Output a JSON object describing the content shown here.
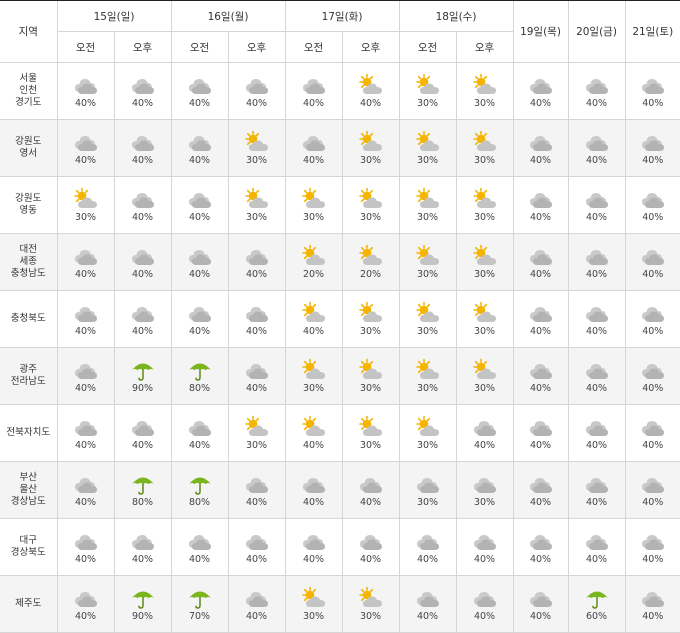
{
  "header": {
    "region_label": "지역",
    "am_label": "오전",
    "pm_label": "오후",
    "days_split": [
      "15일(일)",
      "16일(월)",
      "17일(화)",
      "18일(수)"
    ],
    "days_single": [
      "19일(목)",
      "20일(금)",
      "21일(토)"
    ]
  },
  "icon_legend": {
    "cloud": "cloudy-icon",
    "sun": "partly-sunny-icon",
    "umbrella": "umbrella-rain-icon"
  },
  "colors": {
    "cloud": "#b3b3b3",
    "sun": "#f5b400",
    "umbrella": "#7ab51d",
    "row_shade": "#f4f4f4"
  },
  "rows": [
    {
      "region": "서울\n인천\n경기도",
      "cells": [
        {
          "icon": "cloud",
          "pct": "40%"
        },
        {
          "icon": "cloud",
          "pct": "40%"
        },
        {
          "icon": "cloud",
          "pct": "40%"
        },
        {
          "icon": "cloud",
          "pct": "40%"
        },
        {
          "icon": "cloud",
          "pct": "40%"
        },
        {
          "icon": "sun",
          "pct": "40%"
        },
        {
          "icon": "sun",
          "pct": "30%"
        },
        {
          "icon": "sun",
          "pct": "30%"
        },
        {
          "icon": "cloud",
          "pct": "40%"
        },
        {
          "icon": "cloud",
          "pct": "40%"
        },
        {
          "icon": "cloud",
          "pct": "40%"
        }
      ]
    },
    {
      "region": "강원도\n영서",
      "cells": [
        {
          "icon": "cloud",
          "pct": "40%"
        },
        {
          "icon": "cloud",
          "pct": "40%"
        },
        {
          "icon": "cloud",
          "pct": "40%"
        },
        {
          "icon": "sun",
          "pct": "30%"
        },
        {
          "icon": "cloud",
          "pct": "40%"
        },
        {
          "icon": "sun",
          "pct": "30%"
        },
        {
          "icon": "sun",
          "pct": "30%"
        },
        {
          "icon": "sun",
          "pct": "30%"
        },
        {
          "icon": "cloud",
          "pct": "40%"
        },
        {
          "icon": "cloud",
          "pct": "40%"
        },
        {
          "icon": "cloud",
          "pct": "40%"
        }
      ]
    },
    {
      "region": "강원도\n영동",
      "cells": [
        {
          "icon": "sun",
          "pct": "30%"
        },
        {
          "icon": "cloud",
          "pct": "40%"
        },
        {
          "icon": "cloud",
          "pct": "40%"
        },
        {
          "icon": "sun",
          "pct": "30%"
        },
        {
          "icon": "sun",
          "pct": "30%"
        },
        {
          "icon": "sun",
          "pct": "30%"
        },
        {
          "icon": "sun",
          "pct": "30%"
        },
        {
          "icon": "sun",
          "pct": "30%"
        },
        {
          "icon": "cloud",
          "pct": "40%"
        },
        {
          "icon": "cloud",
          "pct": "40%"
        },
        {
          "icon": "cloud",
          "pct": "40%"
        }
      ]
    },
    {
      "region": "대전\n세종\n충청남도",
      "cells": [
        {
          "icon": "cloud",
          "pct": "40%"
        },
        {
          "icon": "cloud",
          "pct": "40%"
        },
        {
          "icon": "cloud",
          "pct": "40%"
        },
        {
          "icon": "cloud",
          "pct": "40%"
        },
        {
          "icon": "sun",
          "pct": "20%"
        },
        {
          "icon": "sun",
          "pct": "20%"
        },
        {
          "icon": "sun",
          "pct": "30%"
        },
        {
          "icon": "sun",
          "pct": "30%"
        },
        {
          "icon": "cloud",
          "pct": "40%"
        },
        {
          "icon": "cloud",
          "pct": "40%"
        },
        {
          "icon": "cloud",
          "pct": "40%"
        }
      ]
    },
    {
      "region": "충청북도",
      "cells": [
        {
          "icon": "cloud",
          "pct": "40%"
        },
        {
          "icon": "cloud",
          "pct": "40%"
        },
        {
          "icon": "cloud",
          "pct": "40%"
        },
        {
          "icon": "cloud",
          "pct": "40%"
        },
        {
          "icon": "sun",
          "pct": "40%"
        },
        {
          "icon": "sun",
          "pct": "30%"
        },
        {
          "icon": "sun",
          "pct": "30%"
        },
        {
          "icon": "sun",
          "pct": "30%"
        },
        {
          "icon": "cloud",
          "pct": "40%"
        },
        {
          "icon": "cloud",
          "pct": "40%"
        },
        {
          "icon": "cloud",
          "pct": "40%"
        }
      ]
    },
    {
      "region": "광주\n전라남도",
      "cells": [
        {
          "icon": "cloud",
          "pct": "40%"
        },
        {
          "icon": "umbrella",
          "pct": "90%"
        },
        {
          "icon": "umbrella",
          "pct": "80%"
        },
        {
          "icon": "cloud",
          "pct": "40%"
        },
        {
          "icon": "sun",
          "pct": "30%"
        },
        {
          "icon": "sun",
          "pct": "30%"
        },
        {
          "icon": "sun",
          "pct": "30%"
        },
        {
          "icon": "sun",
          "pct": "30%"
        },
        {
          "icon": "cloud",
          "pct": "40%"
        },
        {
          "icon": "cloud",
          "pct": "40%"
        },
        {
          "icon": "cloud",
          "pct": "40%"
        }
      ]
    },
    {
      "region": "전북자치도",
      "cells": [
        {
          "icon": "cloud",
          "pct": "40%"
        },
        {
          "icon": "cloud",
          "pct": "40%"
        },
        {
          "icon": "cloud",
          "pct": "40%"
        },
        {
          "icon": "sun",
          "pct": "30%"
        },
        {
          "icon": "sun",
          "pct": "40%"
        },
        {
          "icon": "sun",
          "pct": "30%"
        },
        {
          "icon": "sun",
          "pct": "30%"
        },
        {
          "icon": "cloud",
          "pct": "40%"
        },
        {
          "icon": "cloud",
          "pct": "40%"
        },
        {
          "icon": "cloud",
          "pct": "40%"
        },
        {
          "icon": "cloud",
          "pct": "40%"
        }
      ]
    },
    {
      "region": "부산\n울산\n경상남도",
      "cells": [
        {
          "icon": "cloud",
          "pct": "40%"
        },
        {
          "icon": "umbrella",
          "pct": "80%"
        },
        {
          "icon": "umbrella",
          "pct": "80%"
        },
        {
          "icon": "cloud",
          "pct": "40%"
        },
        {
          "icon": "cloud",
          "pct": "40%"
        },
        {
          "icon": "cloud",
          "pct": "40%"
        },
        {
          "icon": "cloud",
          "pct": "30%"
        },
        {
          "icon": "cloud",
          "pct": "30%"
        },
        {
          "icon": "cloud",
          "pct": "40%"
        },
        {
          "icon": "cloud",
          "pct": "40%"
        },
        {
          "icon": "cloud",
          "pct": "40%"
        }
      ]
    },
    {
      "region": "대구\n경상북도",
      "cells": [
        {
          "icon": "cloud",
          "pct": "40%"
        },
        {
          "icon": "cloud",
          "pct": "40%"
        },
        {
          "icon": "cloud",
          "pct": "40%"
        },
        {
          "icon": "cloud",
          "pct": "40%"
        },
        {
          "icon": "cloud",
          "pct": "40%"
        },
        {
          "icon": "cloud",
          "pct": "40%"
        },
        {
          "icon": "cloud",
          "pct": "40%"
        },
        {
          "icon": "cloud",
          "pct": "40%"
        },
        {
          "icon": "cloud",
          "pct": "40%"
        },
        {
          "icon": "cloud",
          "pct": "40%"
        },
        {
          "icon": "cloud",
          "pct": "40%"
        }
      ]
    },
    {
      "region": "제주도",
      "cells": [
        {
          "icon": "cloud",
          "pct": "40%"
        },
        {
          "icon": "umbrella",
          "pct": "90%"
        },
        {
          "icon": "umbrella",
          "pct": "70%"
        },
        {
          "icon": "cloud",
          "pct": "40%"
        },
        {
          "icon": "sun",
          "pct": "30%"
        },
        {
          "icon": "sun",
          "pct": "30%"
        },
        {
          "icon": "cloud",
          "pct": "40%"
        },
        {
          "icon": "cloud",
          "pct": "40%"
        },
        {
          "icon": "cloud",
          "pct": "40%"
        },
        {
          "icon": "umbrella",
          "pct": "60%"
        },
        {
          "icon": "cloud",
          "pct": "40%"
        }
      ]
    }
  ]
}
